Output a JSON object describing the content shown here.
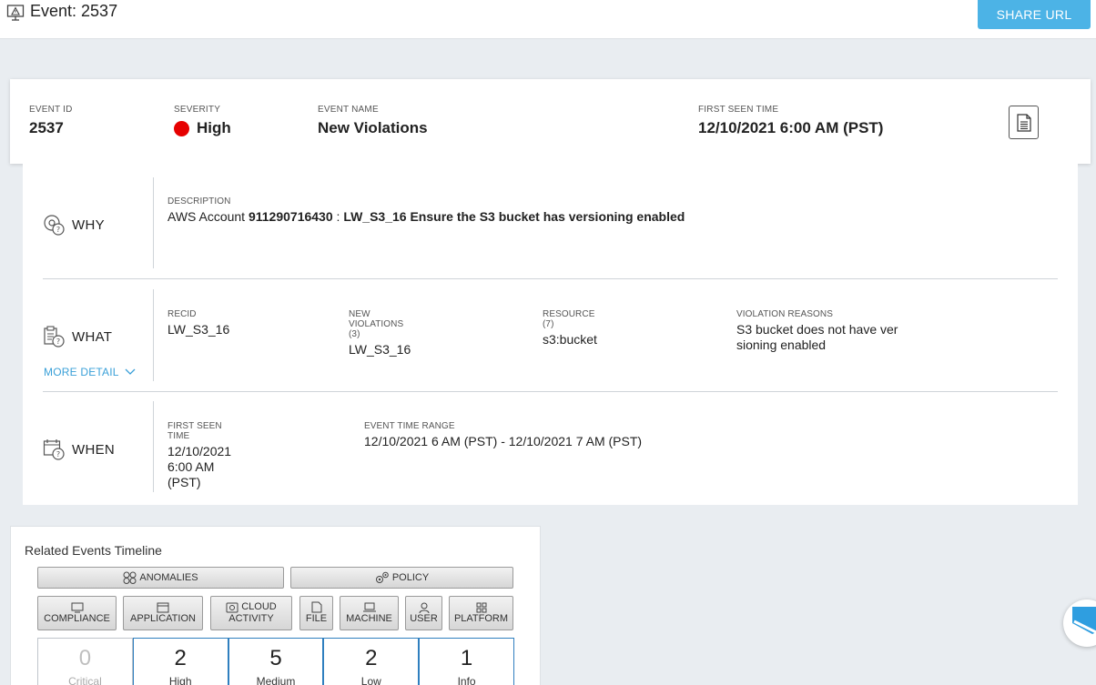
{
  "header": {
    "title": "Event: 2537",
    "share_label": "SHARE URL"
  },
  "summary": {
    "event_id_label": "EVENT ID",
    "event_id": "2537",
    "severity_label": "SEVERITY",
    "severity": "High",
    "severity_color": "#e60000",
    "event_name_label": "EVENT NAME",
    "event_name": "New Violations",
    "first_seen_label": "FIRST SEEN TIME",
    "first_seen": "12/10/2021 6:00 AM (PST)"
  },
  "why": {
    "label": "WHY",
    "description_label": "DESCRIPTION",
    "desc_prefix": "AWS Account",
    "account": "911290716430",
    "sep": ":",
    "rule_text": "LW_S3_16 Ensure the S3 bucket has versioning enabled"
  },
  "what": {
    "label": "WHAT",
    "more_detail": "MORE DETAIL",
    "recid_label": "RECID",
    "recid": "LW_S3_16",
    "new_violations_label": "NEW VIOLATIONS (3)",
    "new_violations": "LW_S3_16",
    "resource_label": "RESOURCE (7)",
    "resource": "s3:bucket",
    "reasons_label": "VIOLATION REASONS",
    "reasons_line1": "S3 bucket does not have ver",
    "reasons_line2": "sioning enabled"
  },
  "when": {
    "label": "WHEN",
    "first_seen_label": "FIRST SEEN TIME",
    "first_seen": "12/10/2021 6:00 AM (PST)",
    "range_label": "EVENT TIME RANGE",
    "range": "12/10/2021 6 AM (PST) - 12/10/2021 7 AM (PST)"
  },
  "timeline": {
    "title": "Related Events Timeline",
    "anomalies": "ANOMALIES",
    "policy": "POLICY",
    "filters": [
      {
        "l1": "COMPLIANCE",
        "l2": "",
        "icon": "monitor-icon"
      },
      {
        "l1": "APPLICATION",
        "l2": "",
        "icon": "window-icon"
      },
      {
        "l1": "CLOUD",
        "l2": "ACTIVITY",
        "icon": "cloud-icon"
      },
      {
        "l1": "FILE",
        "l2": "",
        "icon": "file-icon"
      },
      {
        "l1": "MACHINE",
        "l2": "",
        "icon": "laptop-icon"
      },
      {
        "l1": "USER",
        "l2": "",
        "icon": "user-icon"
      },
      {
        "l1": "PLATFORM",
        "l2": "",
        "icon": "grid-icon"
      }
    ],
    "counts": [
      {
        "num": "0",
        "label": "Critical"
      },
      {
        "num": "2",
        "label": "High"
      },
      {
        "num": "5",
        "label": "Medium"
      },
      {
        "num": "2",
        "label": "Low"
      },
      {
        "num": "1",
        "label": "Info"
      }
    ]
  }
}
